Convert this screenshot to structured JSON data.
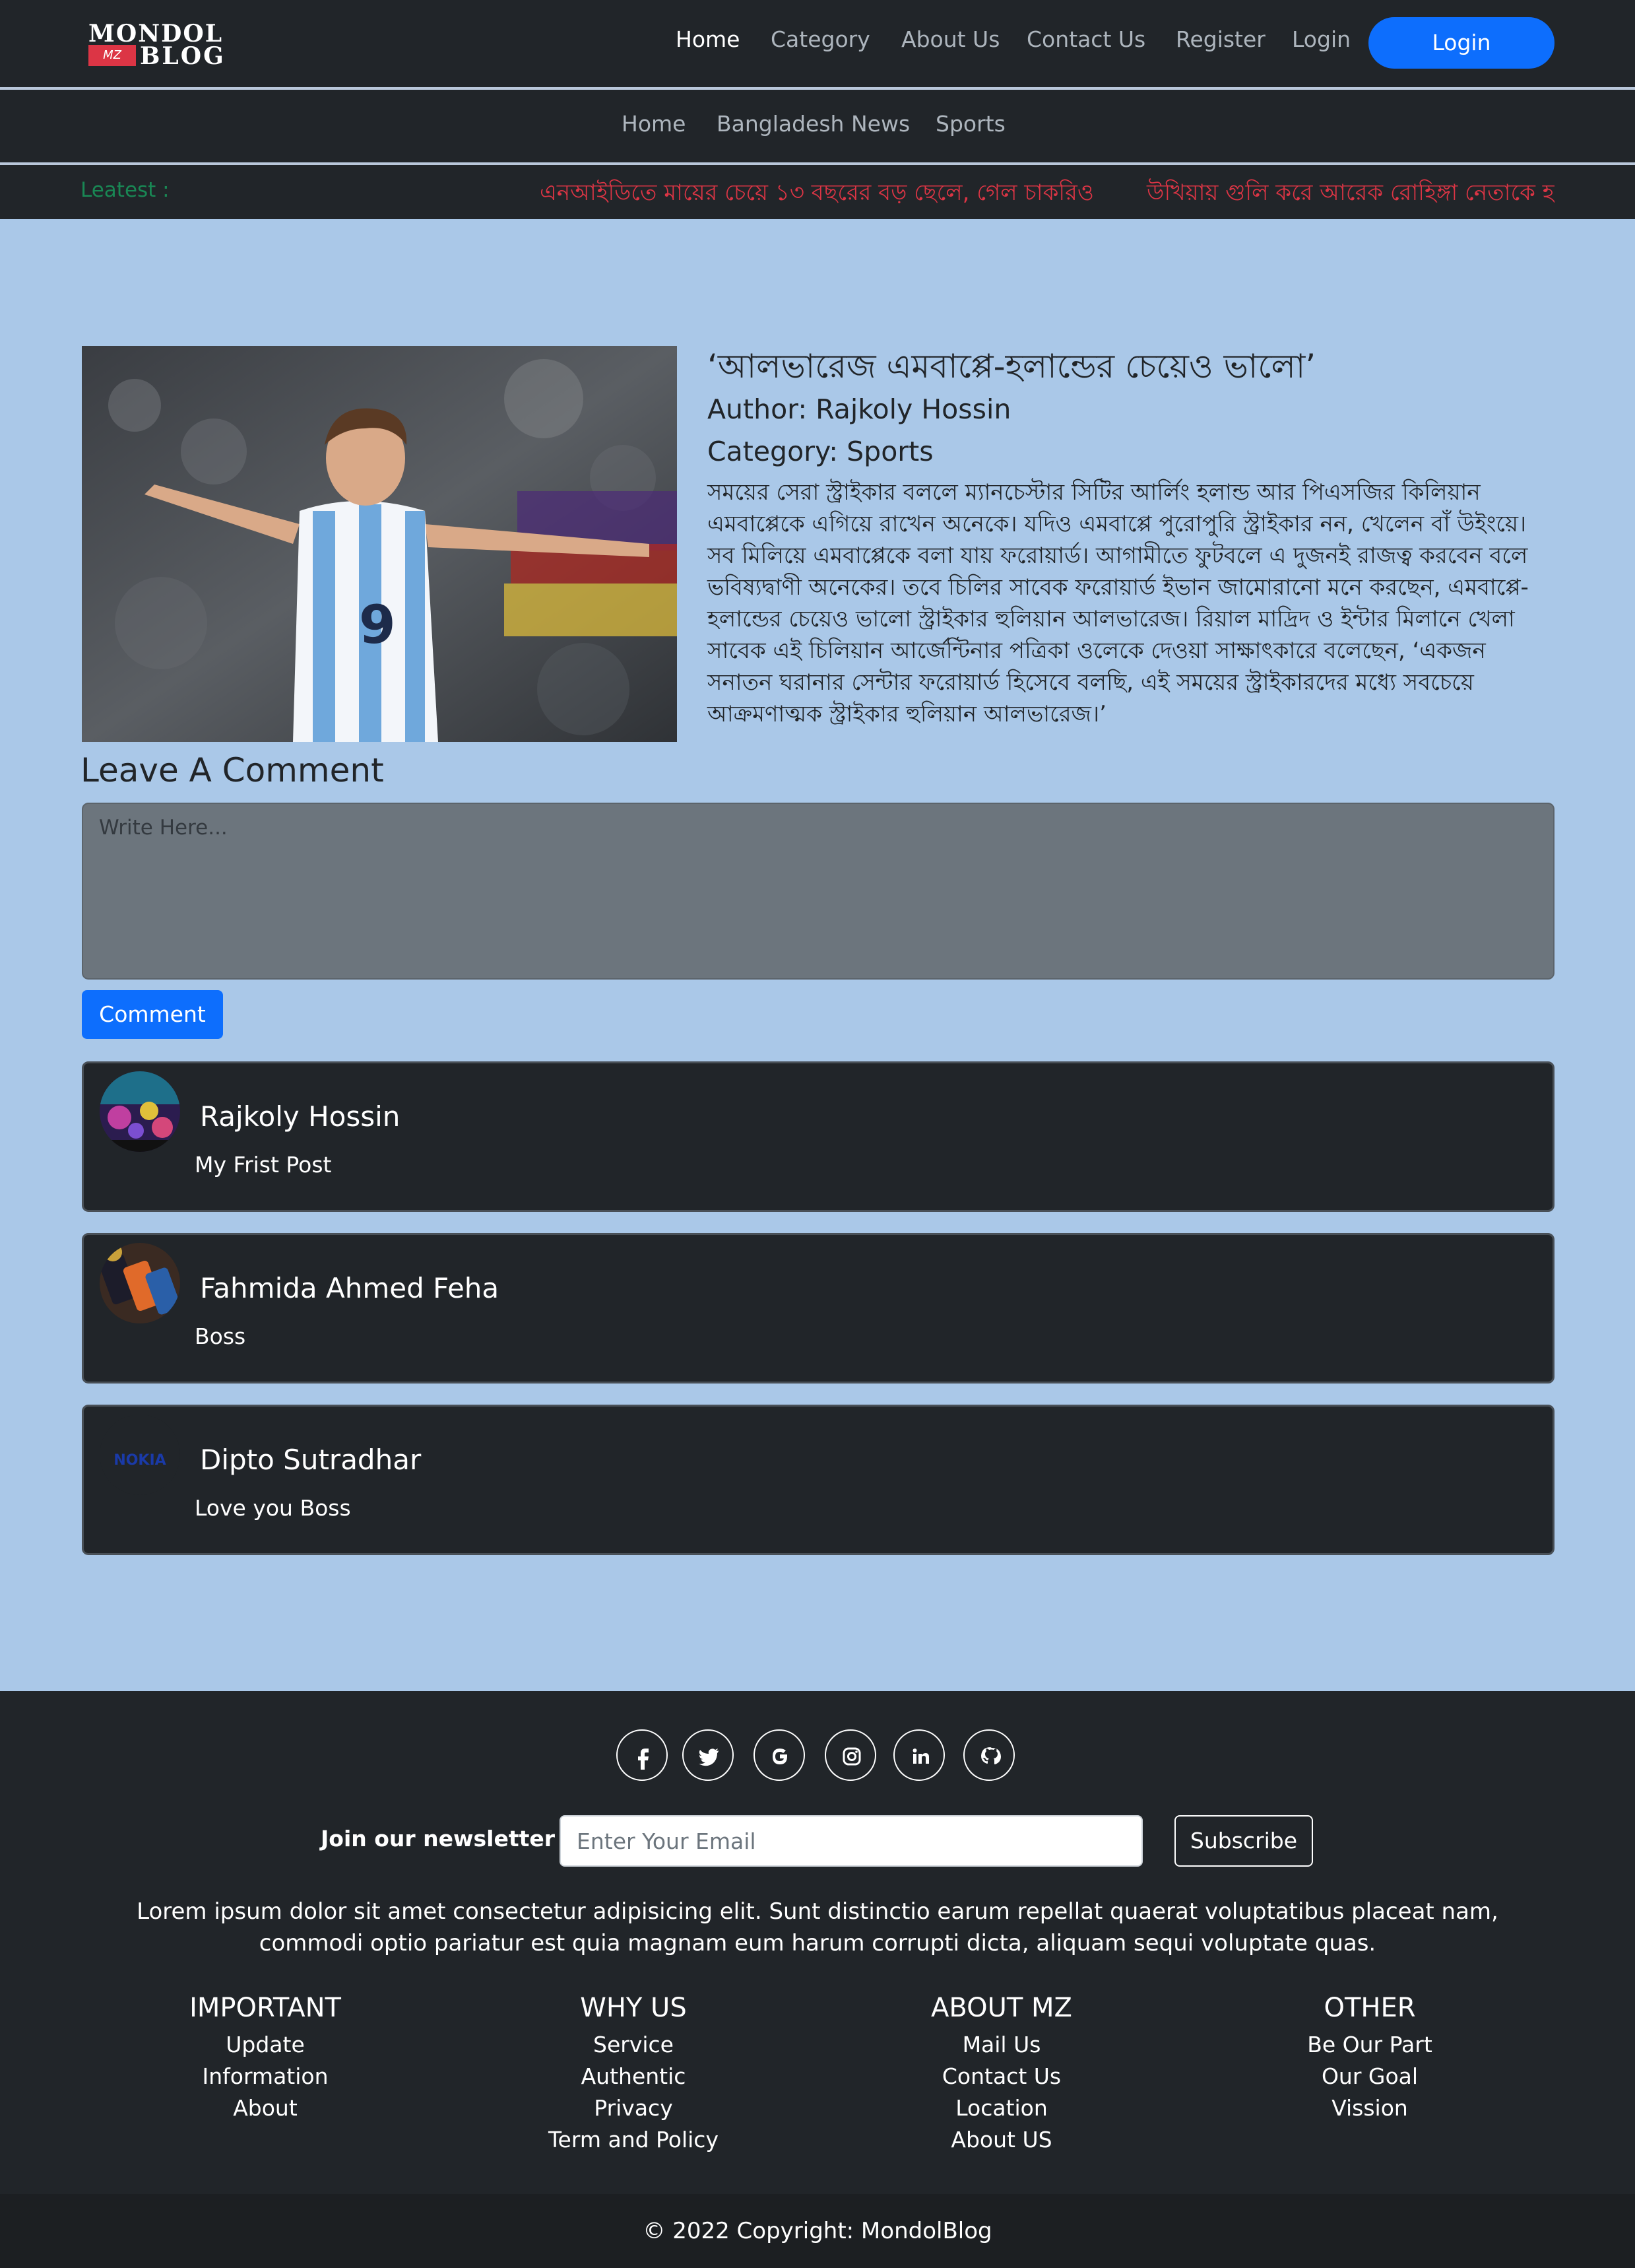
{
  "header": {
    "logo": {
      "line1": "MONDOL",
      "badge": "MZ",
      "line2": "BLOG"
    },
    "nav": [
      "Home",
      "Category",
      "About Us",
      "Contact Us",
      "Register",
      "Login"
    ],
    "login_button": "Login"
  },
  "subnav": [
    "Home",
    "Bangladesh News",
    "Sports"
  ],
  "ticker": {
    "label": "Leatest :",
    "headlines": [
      "এনআইডিতে মায়ের চেয়ে ১৩ বছরের বড় ছেলে, গেল চাকরিও",
      "উখিয়ায় গুলি করে আরেক রোহিঙ্গা নেতাকে হ"
    ]
  },
  "article": {
    "title": "‘আলভারেজ এমবাপ্পে-হলান্ডের চেয়েও ভালো’",
    "author": "Author: Rajkoly Hossin",
    "category": "Category: Sports",
    "body": "সময়ের সেরা স্ট্রাইকার বললে ম্যানচেস্টার সিটির আর্লিং হলান্ড আর পিএসজির কিলিয়ান এমবাপ্পেকে এগিয়ে রাখেন অনেকে। যদিও এমবাপ্পে পুরোপুরি স্ট্রাইকার নন, খেলেন বাঁ উইংয়ে। সব মিলিয়ে এমবাপ্পেকে বলা যায় ফরোয়ার্ড। আগামীতে ফুটবলে এ দুজনই রাজত্ব করবেন বলে ভবিষ্যদ্বাণী অনেকের। তবে চিলির সাবেক ফরোয়ার্ড ইভান জামোরানো মনে করছেন, এমবাপ্পে-হলান্ডের চেয়েও ভালো স্ট্রাইকার হুলিয়ান আলভারেজ। রিয়াল মাদ্রিদ ও ইন্টার মিলানে খেলা সাবেক এই চিলিয়ান আর্জেন্টিনার পত্রিকা ওলেকে দেওয়া সাক্ষাৎকারে বলেছেন, ‘একজন সনাতন ঘরানার সেন্টার ফরোয়ার্ড হিসেবে বলছি, এই সময়ের স্ট্রাইকারদের মধ্যে সবচেয়ে আক্রমণাত্মক স্ট্রাইকার হুলিয়ান আলভারেজ।’"
  },
  "comment_form": {
    "heading": "Leave A Comment",
    "placeholder": "Write Here...",
    "button": "Comment"
  },
  "comments": [
    {
      "name": "Rajkoly Hossin",
      "text": "My Frist Post",
      "avatar": "aquarium-avatar"
    },
    {
      "name": "Fahmida Ahmed Feha",
      "text": "Boss",
      "avatar": "phones-avatar"
    },
    {
      "name": "Dipto Sutradhar",
      "text": "Love you Boss",
      "avatar": "nokia-avatar",
      "avatar_text": "NOKIA"
    }
  ],
  "footer": {
    "social": [
      "facebook-icon",
      "twitter-icon",
      "google-icon",
      "instagram-icon",
      "linkedin-icon",
      "github-icon"
    ],
    "newsletter_label": "Join our newsletter",
    "email_placeholder": "Enter Your Email",
    "subscribe_button": "Subscribe",
    "lorem": "Lorem ipsum dolor sit amet consectetur adipisicing elit. Sunt distinctio earum repellat quaerat voluptatibus placeat nam, commodi optio pariatur est quia magnam eum harum corrupti dicta, aliquam sequi voluptate quas.",
    "columns": [
      {
        "heading": "IMPORTANT",
        "items": [
          "Update",
          "Information",
          "About"
        ]
      },
      {
        "heading": "WHY US",
        "items": [
          "Service",
          "Authentic",
          "Privacy",
          "Term and Policy"
        ]
      },
      {
        "heading": "ABOUT MZ",
        "items": [
          "Mail Us",
          "Contact Us",
          "Location",
          "About US"
        ]
      },
      {
        "heading": "OTHER",
        "items": [
          "Be Our Part",
          "Our Goal",
          "Vission"
        ]
      }
    ],
    "copyright": "© 2022 Copyright: MondolBlog"
  },
  "colors": {
    "page_bg": "#aac8e8",
    "dark": "#212529",
    "primary": "#0d6efd",
    "ticker_label": "#198754",
    "ticker_text": "#dc3545"
  }
}
